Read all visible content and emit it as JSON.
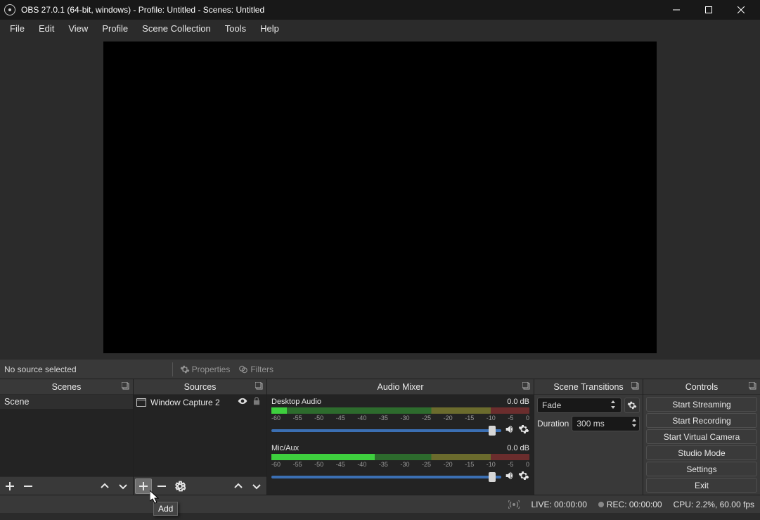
{
  "titlebar": {
    "title": "OBS 27.0.1 (64-bit, windows) - Profile: Untitled - Scenes: Untitled"
  },
  "menu": {
    "items": [
      "File",
      "Edit",
      "View",
      "Profile",
      "Scene Collection",
      "Tools",
      "Help"
    ]
  },
  "srcinfo": {
    "status": "No source selected",
    "properties": "Properties",
    "filters": "Filters"
  },
  "docks": {
    "scenes": {
      "title": "Scenes",
      "items": [
        "Scene"
      ]
    },
    "sources": {
      "title": "Sources",
      "items": [
        {
          "name": "Window Capture 2"
        }
      ],
      "add_tooltip": "Add"
    },
    "mixer": {
      "title": "Audio Mixer",
      "channels": [
        {
          "name": "Desktop Audio",
          "level": "0.0 dB"
        },
        {
          "name": "Mic/Aux",
          "level": "0.0 dB"
        }
      ],
      "ticks": [
        "-60",
        "-55",
        "-50",
        "-45",
        "-40",
        "-35",
        "-30",
        "-25",
        "-20",
        "-15",
        "-10",
        "-5",
        "0"
      ]
    },
    "transitions": {
      "title": "Scene Transitions",
      "current": "Fade",
      "duration_label": "Duration",
      "duration_value": "300 ms"
    },
    "controls": {
      "title": "Controls",
      "buttons": [
        "Start Streaming",
        "Start Recording",
        "Start Virtual Camera",
        "Studio Mode",
        "Settings",
        "Exit"
      ]
    }
  },
  "statusbar": {
    "live": "LIVE: 00:00:00",
    "rec": "REC: 00:00:00",
    "cpu": "CPU: 2.2%, 60.00 fps"
  }
}
